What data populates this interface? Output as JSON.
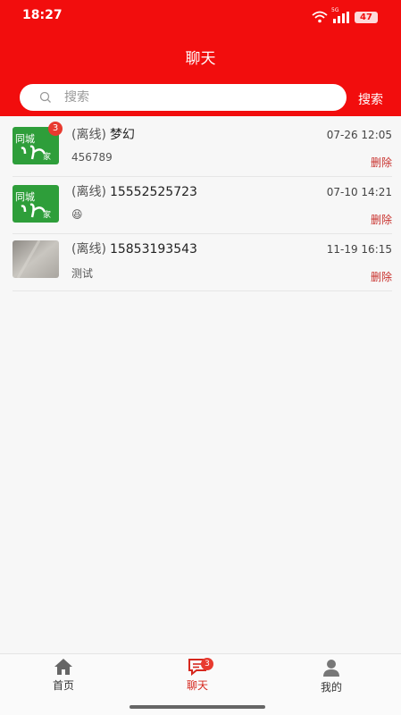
{
  "status_bar": {
    "time": "18:27",
    "network": "5G",
    "battery": "47"
  },
  "header": {
    "title": "聊天",
    "search_placeholder": "搜索",
    "search_button": "搜索"
  },
  "chats": [
    {
      "status": "(离线)",
      "name": "梦幻",
      "time": "07-26 12:05",
      "message": "456789",
      "delete": "删除",
      "unread": "3",
      "avatar": "tongcheng-logo"
    },
    {
      "status": "(离线)",
      "name": "15552525723",
      "time": "07-10 14:21",
      "message": "😆",
      "delete": "删除",
      "unread": "",
      "avatar": "tongcheng-logo"
    },
    {
      "status": "(离线)",
      "name": "15853193543",
      "time": "11-19 16:15",
      "message": "测试",
      "delete": "删除",
      "unread": "",
      "avatar": "photo"
    }
  ],
  "tabs": [
    {
      "label": "首页",
      "icon": "home-icon"
    },
    {
      "label": "聊天",
      "icon": "chat-icon",
      "badge": "3",
      "active": true
    },
    {
      "label": "我的",
      "icon": "person-icon"
    }
  ],
  "colors": {
    "brand": "#f20d0d",
    "delete": "#c8302c",
    "logo_green": "#2e9e3a"
  }
}
